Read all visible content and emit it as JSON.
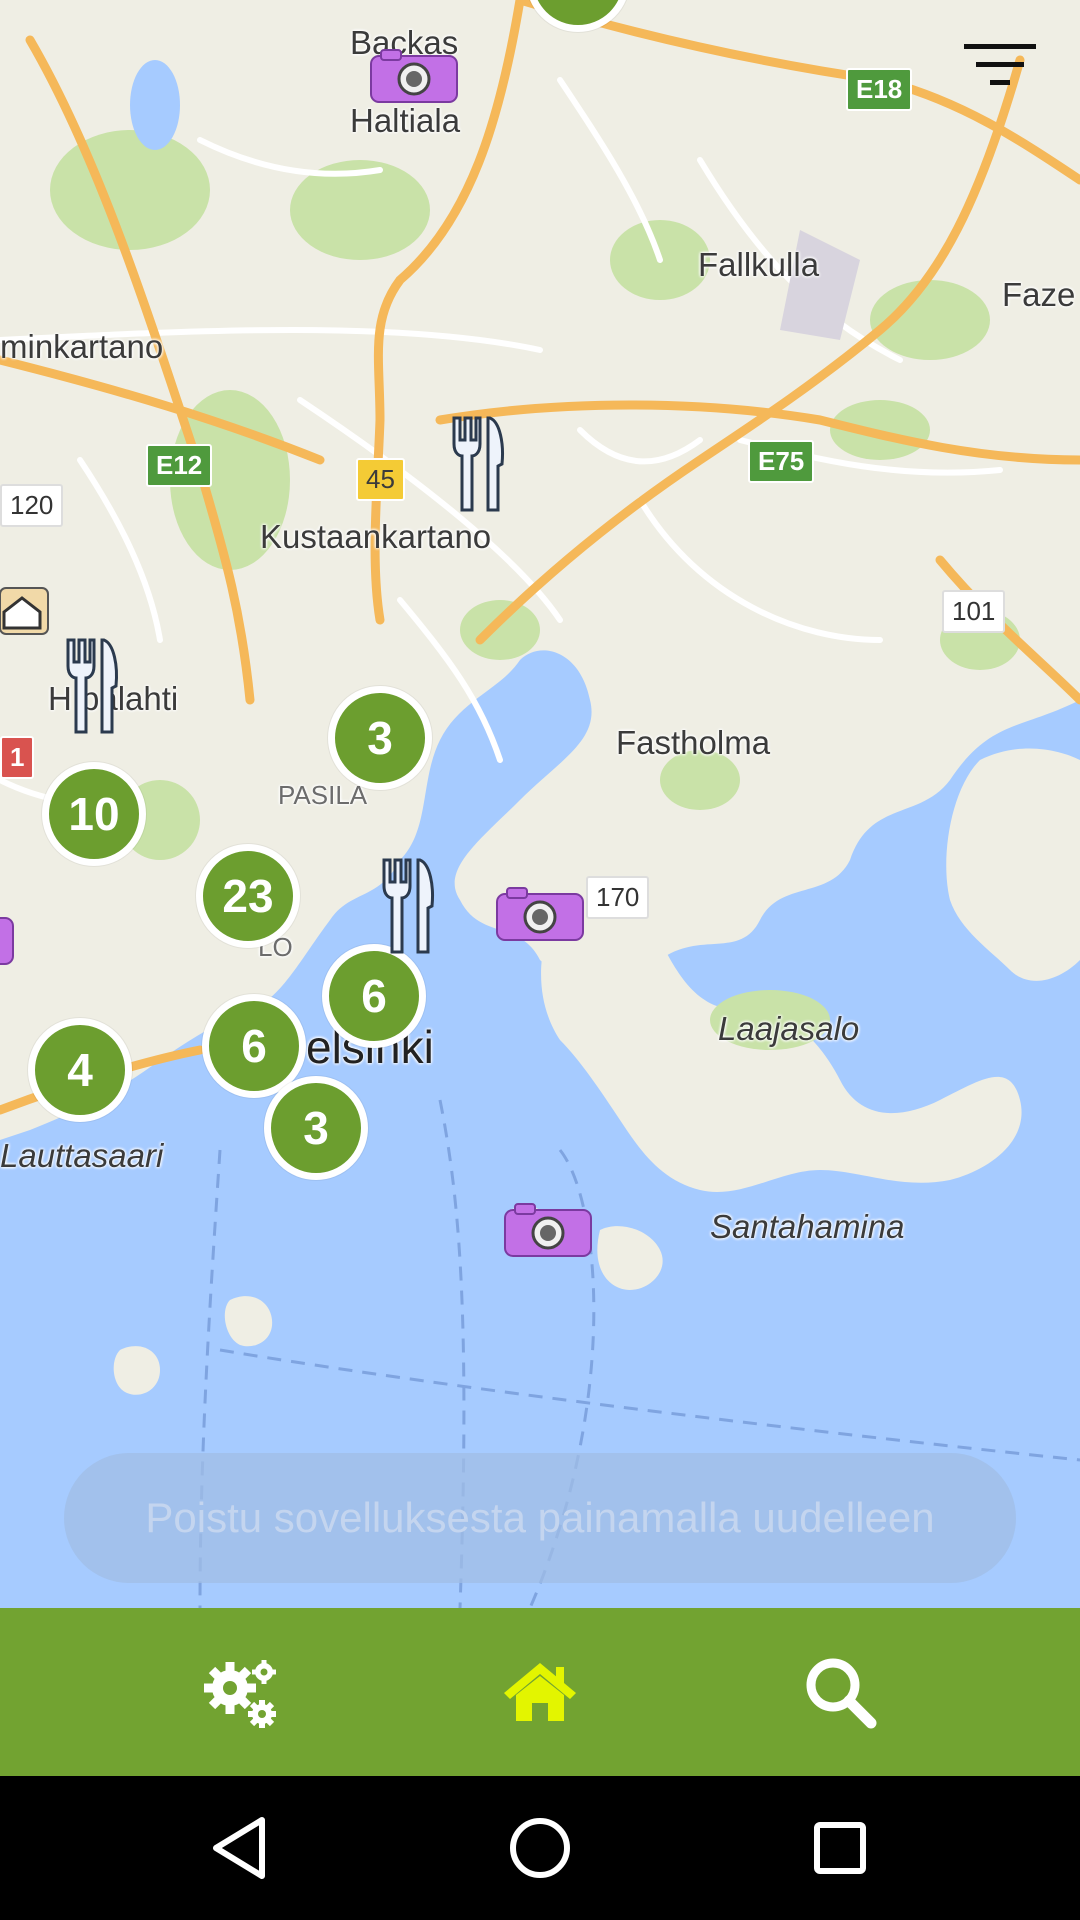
{
  "map": {
    "places": [
      {
        "id": "backas",
        "label": "Backas"
      },
      {
        "id": "haltiala",
        "label": "Haltiala"
      },
      {
        "id": "fallkulla",
        "label": "Fallkulla"
      },
      {
        "id": "faze",
        "label": "Faze"
      },
      {
        "id": "minkartano",
        "label": "minkartano"
      },
      {
        "id": "kustaankartano",
        "label": "Kustaankartano"
      },
      {
        "id": "hu_palahti",
        "label": "H palahti"
      },
      {
        "id": "pasila",
        "label": "PASILA"
      },
      {
        "id": "fastholma",
        "label": "Fastholma"
      },
      {
        "id": "laajasalo",
        "label": "Laajasalo"
      },
      {
        "id": "lauttasaari",
        "label": "Lauttasaari"
      },
      {
        "id": "santahamina",
        "label": "Santahamina"
      },
      {
        "id": "helsinki",
        "label": "elsinki"
      },
      {
        "id": "lo",
        "label": "LO"
      }
    ],
    "road_shields": [
      {
        "id": "e18",
        "label": "E18",
        "style": "green"
      },
      {
        "id": "e12",
        "label": "E12",
        "style": "green"
      },
      {
        "id": "e75",
        "label": "E75",
        "style": "green"
      },
      {
        "id": "r45",
        "label": "45",
        "style": "yellow"
      },
      {
        "id": "r120",
        "label": "120",
        "style": "white"
      },
      {
        "id": "r101",
        "label": "101",
        "style": "white"
      },
      {
        "id": "r170",
        "label": "170",
        "style": "white"
      },
      {
        "id": "r1",
        "label": "1",
        "style": "red"
      }
    ],
    "clusters": [
      {
        "id": "c3a",
        "count": "3"
      },
      {
        "id": "c10",
        "count": "10"
      },
      {
        "id": "c23",
        "count": "23"
      },
      {
        "id": "c6a",
        "count": "6"
      },
      {
        "id": "c6b",
        "count": "6"
      },
      {
        "id": "c4",
        "count": "4"
      },
      {
        "id": "c3b",
        "count": "3"
      }
    ],
    "markers": [
      {
        "id": "cam1",
        "icon": "camera-icon"
      },
      {
        "id": "cam2",
        "icon": "camera-icon"
      },
      {
        "id": "cam3",
        "icon": "camera-icon"
      },
      {
        "id": "fork1",
        "icon": "restaurant-icon"
      },
      {
        "id": "fork2",
        "icon": "restaurant-icon"
      },
      {
        "id": "fork3",
        "icon": "restaurant-icon"
      },
      {
        "id": "home1",
        "icon": "home-icon"
      }
    ]
  },
  "toast": {
    "text": "Poistu sovelluksesta painamalla uudelleen"
  },
  "bottom_bar": {
    "tabs": [
      {
        "id": "settings",
        "icon": "gears-icon",
        "color": "#ffffff"
      },
      {
        "id": "home",
        "icon": "home-icon",
        "color": "#e3f500",
        "active": true
      },
      {
        "id": "search",
        "icon": "search-icon",
        "color": "#ffffff"
      }
    ]
  },
  "colors": {
    "accent": "#72a331",
    "cluster": "#6c9e2f",
    "water": "#a6cbff",
    "land": "#efeee4",
    "highway": "#f5b859"
  }
}
